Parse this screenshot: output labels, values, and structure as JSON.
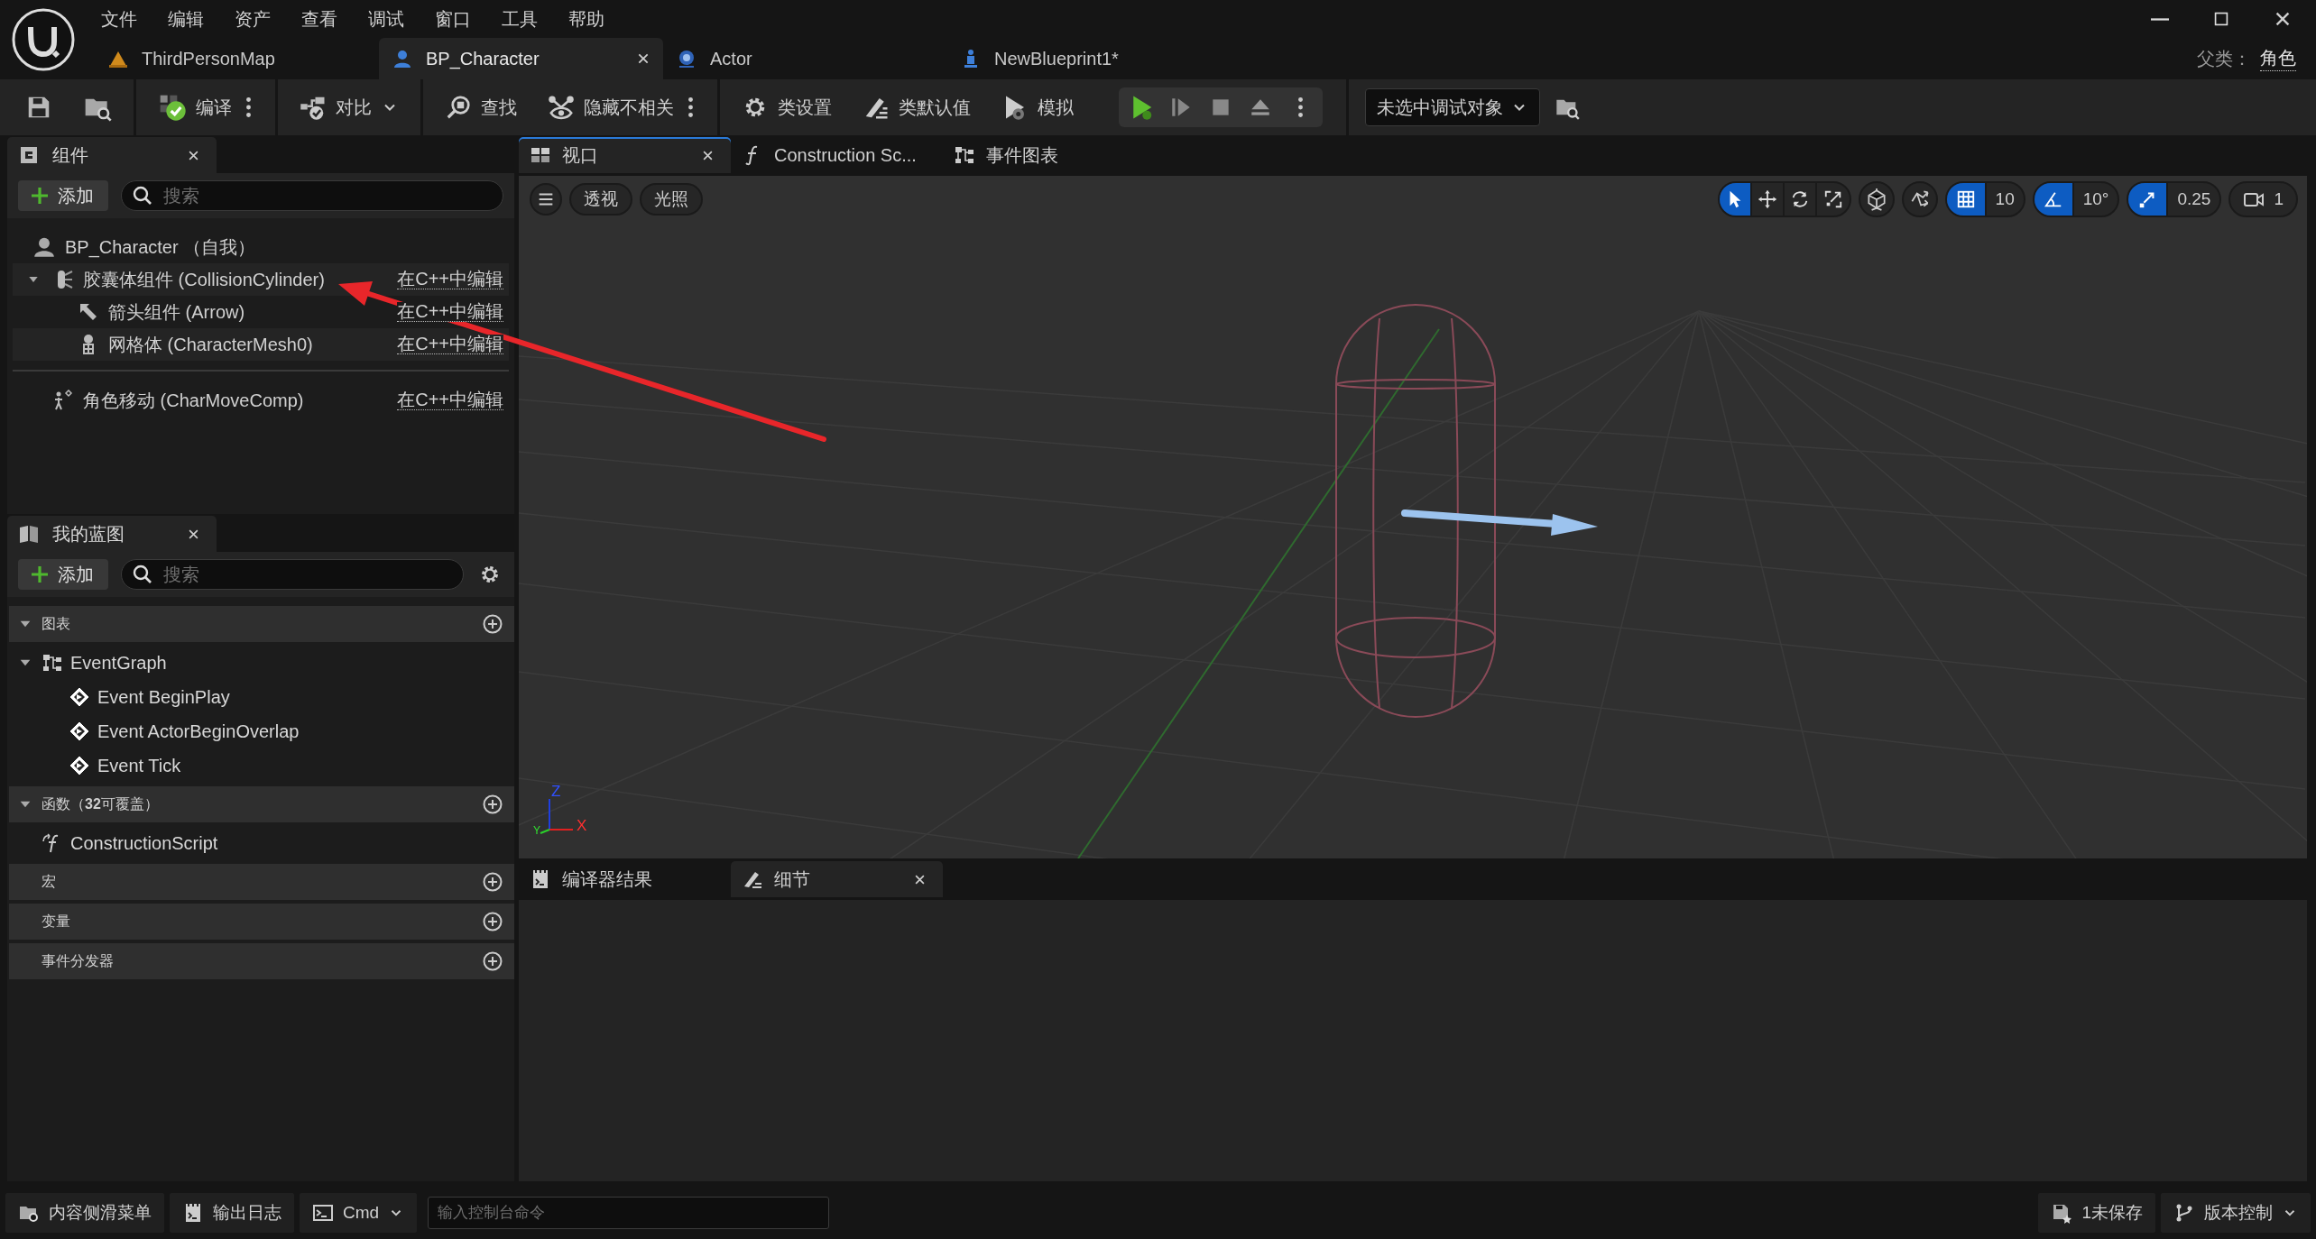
{
  "menu": [
    "文件",
    "编辑",
    "资产",
    "查看",
    "调试",
    "窗口",
    "工具",
    "帮助"
  ],
  "document_tabs": [
    {
      "label": "ThirdPersonMap",
      "kind": "level",
      "selected": false
    },
    {
      "label": "BP_Character",
      "kind": "character",
      "selected": true
    },
    {
      "label": "Actor",
      "kind": "actor",
      "selected": false
    },
    {
      "label": "NewBlueprint1*",
      "kind": "pawn",
      "selected": false
    }
  ],
  "parent_class": {
    "label": "父类：",
    "value": "角色"
  },
  "toolbar": {
    "compile": "编译",
    "diff": "对比",
    "find": "查找",
    "hide_unrelated": "隐藏不相关",
    "class_settings": "类设置",
    "class_defaults": "类默认值",
    "simulate": "模拟",
    "debug_object": "未选中调试对象"
  },
  "components": {
    "title": "组件",
    "add": "添加",
    "search_placeholder": "搜索",
    "root": "BP_Character （自我）",
    "items": [
      {
        "label": "胶囊体组件 (CollisionCylinder)",
        "kind": "capsule",
        "action": "在C++中编辑",
        "expanded": true,
        "children": [
          {
            "label": "箭头组件 (Arrow)",
            "kind": "arrow",
            "action": "在C++中编辑"
          },
          {
            "label": "网格体 (CharacterMesh0)",
            "kind": "mesh",
            "action": "在C++中编辑"
          }
        ]
      },
      {
        "label": "角色移动 (CharMoveComp)",
        "kind": "movement",
        "action": "在C++中编辑",
        "expanded": false
      }
    ]
  },
  "my_blueprint": {
    "title": "我的蓝图",
    "add": "添加",
    "search_placeholder": "搜索",
    "sections": [
      {
        "title": "图表",
        "expanded": true,
        "items": [
          {
            "label": "EventGraph",
            "kind": "graph",
            "expanded": true,
            "children": [
              {
                "label": "Event BeginPlay",
                "kind": "event"
              },
              {
                "label": "Event ActorBeginOverlap",
                "kind": "event"
              },
              {
                "label": "Event Tick",
                "kind": "event"
              }
            ]
          }
        ]
      },
      {
        "title": "函数（**32**可覆盖）",
        "expanded": true,
        "items": [
          {
            "label": "ConstructionScript",
            "kind": "function"
          }
        ]
      },
      {
        "title": "宏",
        "expanded": false
      },
      {
        "title": "变量",
        "expanded": false
      },
      {
        "title": "事件分发器",
        "expanded": false
      }
    ]
  },
  "viewport_tabs": [
    {
      "label": "视口",
      "kind": "viewport",
      "selected": true
    },
    {
      "label": "Construction Sc...",
      "kind": "function",
      "selected": false
    },
    {
      "label": "事件图表",
      "kind": "graph",
      "selected": false
    }
  ],
  "viewport": {
    "view_mode": "透视",
    "lighting": "光照",
    "transform_tools": [
      {
        "kind": "select",
        "selected": true
      },
      {
        "kind": "move",
        "selected": false
      },
      {
        "kind": "rotate",
        "selected": false
      },
      {
        "kind": "scale",
        "selected": false
      }
    ],
    "snaps": [
      {
        "kind": "grid",
        "on": true,
        "value": "10"
      },
      {
        "kind": "angle",
        "on": true,
        "value": "10°"
      },
      {
        "kind": "scale",
        "on": true,
        "value": "0.25"
      }
    ],
    "camera_speed": "1",
    "axes": [
      "Z",
      "X",
      "Y"
    ]
  },
  "bottom_tabs": [
    {
      "label": "编译器结果",
      "kind": "log",
      "selected": false
    },
    {
      "label": "细节",
      "kind": "details",
      "selected": true
    }
  ],
  "status_bar": {
    "content_drawer": "内容侧滑菜单",
    "output_log": "输出日志",
    "cmd": "Cmd",
    "console_placeholder": "输入控制台命令",
    "unsaved": "1未保存",
    "source_control": "版本控制"
  }
}
